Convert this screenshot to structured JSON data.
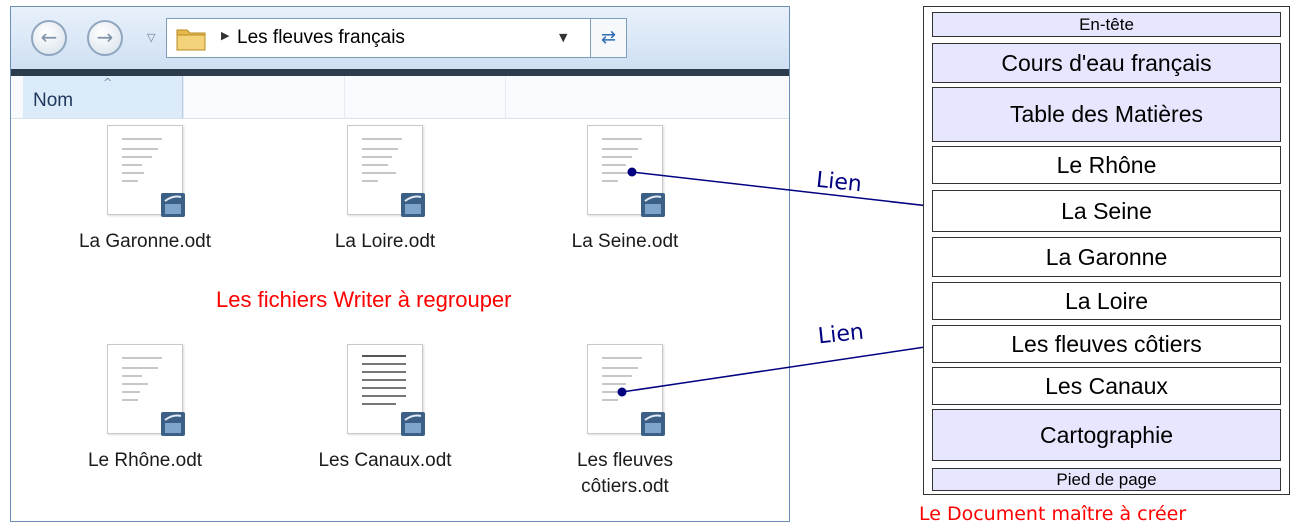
{
  "explorer": {
    "address": {
      "path": "Les fleuves français"
    },
    "columns": [
      {
        "label": "Nom"
      }
    ],
    "files": [
      {
        "name": "La Garonne.odt"
      },
      {
        "name": "La Loire.odt"
      },
      {
        "name": "La Seine.odt"
      },
      {
        "name": "Le Rhône.odt"
      },
      {
        "name": "Les Canaux.odt"
      },
      {
        "name": "Les fleuves côtiers.odt"
      }
    ],
    "caption": "Les fichiers Writer à regrouper"
  },
  "links": [
    {
      "label": "Lien"
    },
    {
      "label": "Lien"
    }
  ],
  "master": {
    "header": "En-tête",
    "title": "Cours d'eau français",
    "toc": "Table des Matières",
    "sections": [
      "Le Rhône",
      "La Seine",
      "La Garonne",
      "La Loire",
      "Les fleuves côtiers",
      "Les Canaux"
    ],
    "cartography": "Cartographie",
    "footer": "Pied de page",
    "caption": "Le Document maître à créer"
  },
  "colors": {
    "link_line": "#000080",
    "caption_red": "#ff0000",
    "section_shade": "#e6e6ff"
  }
}
